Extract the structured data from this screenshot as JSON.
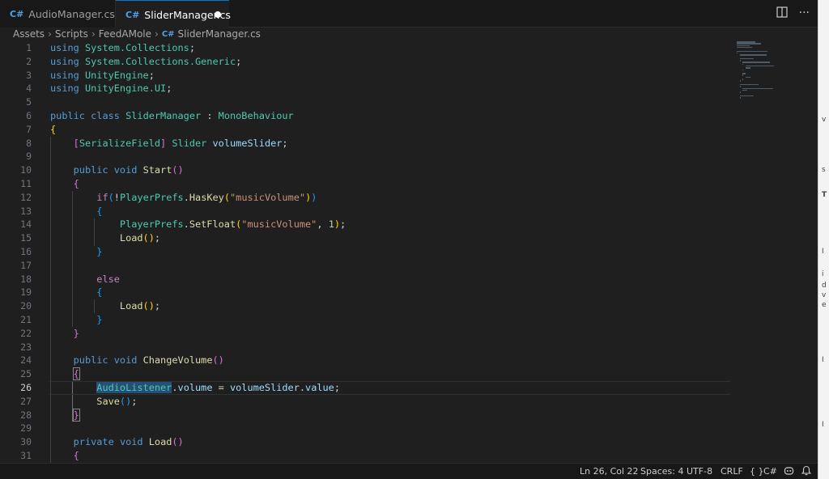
{
  "tabs": [
    {
      "label": "AudioManager.cs",
      "active": false,
      "icon": "csharp-icon"
    },
    {
      "label": "SliderManager.cs",
      "active": true,
      "dirty": true,
      "icon": "csharp-icon"
    }
  ],
  "tab_actions": [
    "split-editor-icon",
    "more-actions-icon"
  ],
  "breadcrumb": [
    "Assets",
    "Scripts",
    "FeedAMole",
    "SliderManager.cs"
  ],
  "editor": {
    "current_line": 26,
    "line_numbers": [
      "1",
      "2",
      "3",
      "4",
      "5",
      "6",
      "7",
      "8",
      "9",
      "10",
      "11",
      "12",
      "13",
      "14",
      "15",
      "16",
      "17",
      "18",
      "19",
      "20",
      "21",
      "22",
      "23",
      "24",
      "25",
      "26",
      "27",
      "28",
      "29",
      "30",
      "31"
    ],
    "tokens": {
      "using": "using",
      "semi": ";",
      "ns_collections": "System.Collections",
      "ns_generic": "System.Collections.Generic",
      "ns_engine": "UnityEngine",
      "ns_ui": "UnityEngine.UI",
      "public": "public",
      "class": "class",
      "classname": "SliderManager",
      "colon": " : ",
      "base": "MonoBehaviour",
      "lbrace": "{",
      "rbrace": "}",
      "attr_open": "[",
      "attr_name": "SerializeField",
      "attr_close": "]",
      "slider_type": "Slider",
      "field_volume": "volumeSlider",
      "void": "void",
      "start": "Start",
      "parens": "()",
      "lparen": "(",
      "rparen": ")",
      "if": "if",
      "not": "!",
      "playerprefs": "PlayerPrefs",
      "dot": ".",
      "haskey": "HasKey",
      "music_volume": "\"musicVolume\"",
      "setfloat": "SetFloat",
      "comma": ", ",
      "one": "1",
      "load": "Load",
      "else": "else",
      "changevolume": "ChangeVolume",
      "audiolistener": "AudioListener",
      "volume": "volume",
      "eq": " = ",
      "value": "value",
      "save": "Save",
      "private": "private"
    }
  },
  "status": {
    "position": "Ln 26, Col 22",
    "spaces": "Spaces: 4",
    "encoding": "UTF-8",
    "eol": "CRLF",
    "braces": "{ }",
    "language": "C#",
    "copilot_icon": "copilot-icon",
    "bell_icon": "bell-icon"
  },
  "right_strip": [
    "v",
    "s",
    "T",
    "I",
    "i",
    "d",
    "v",
    "e",
    "I",
    "I"
  ]
}
